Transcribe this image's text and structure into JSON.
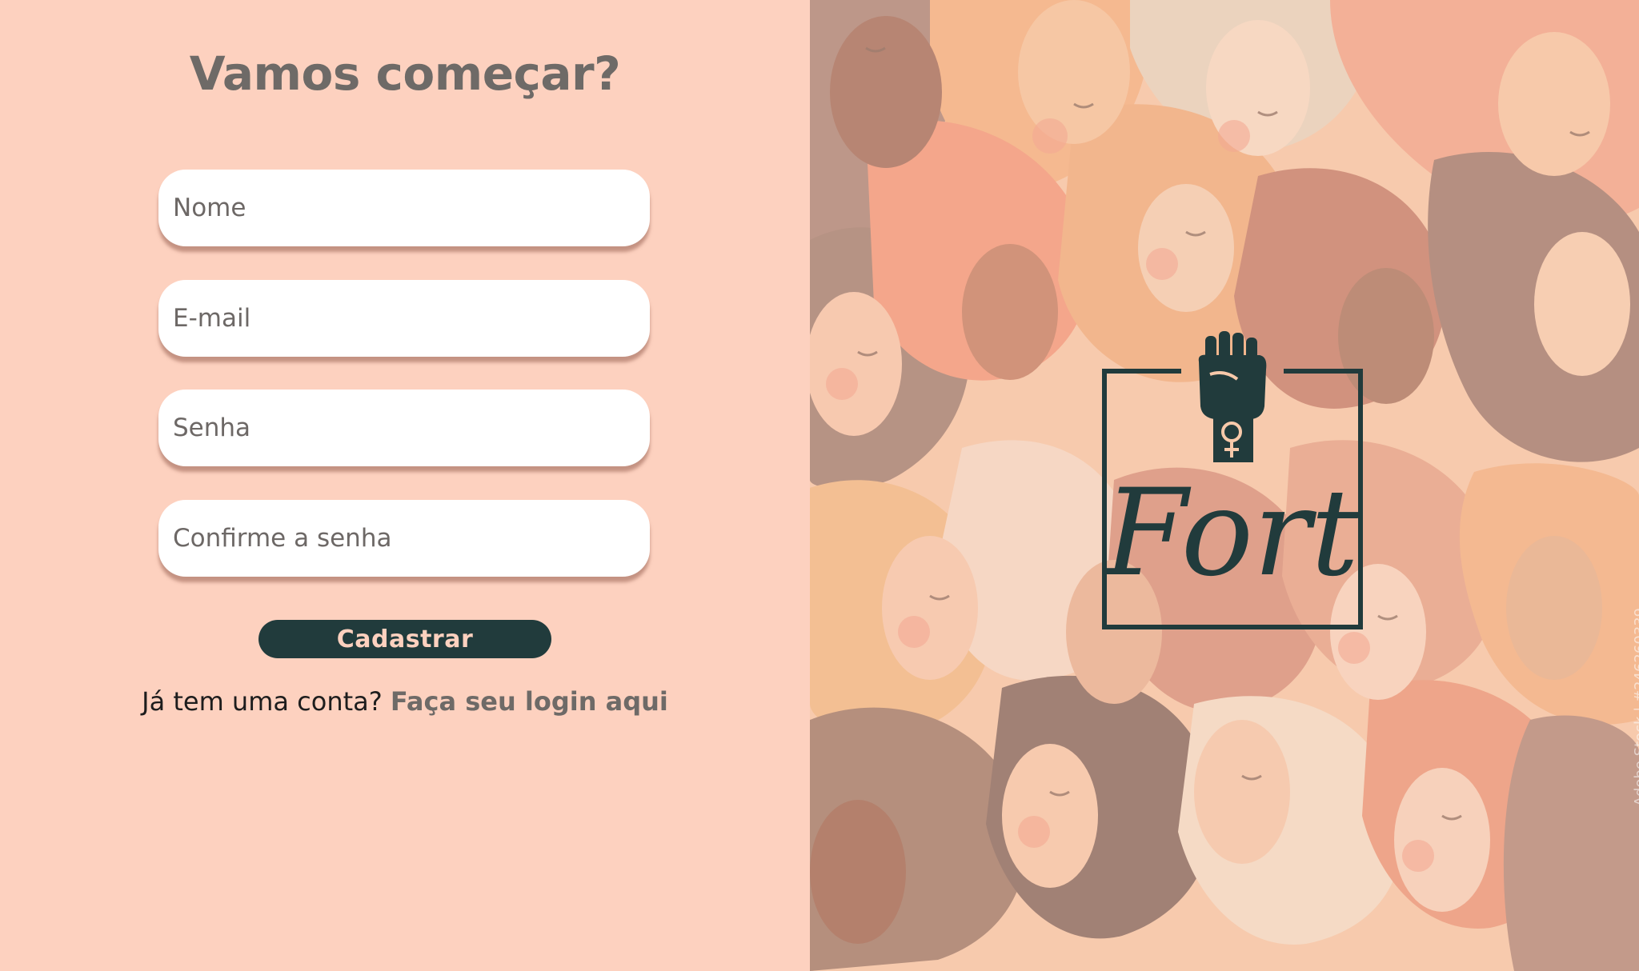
{
  "signup": {
    "title": "Vamos começar?",
    "fields": {
      "name_placeholder": "Nome",
      "email_placeholder": "E-mail",
      "password_placeholder": "Senha",
      "confirm_placeholder": "Confirme a senha"
    },
    "submit_label": "Cadastrar",
    "login_prompt": "Já tem uma conta?",
    "login_link": "Faça seu login aqui"
  },
  "brand": {
    "name": "Fort",
    "icons": [
      "raised-fist-icon",
      "female-symbol-icon"
    ],
    "watermark": "Adobe Stock | #246260339"
  },
  "colors": {
    "left_background": "#fdd1bf",
    "title_text": "#6e6a67",
    "button_background": "#213b3c",
    "button_text": "#fdd1bf",
    "logo": "#213b3c"
  }
}
